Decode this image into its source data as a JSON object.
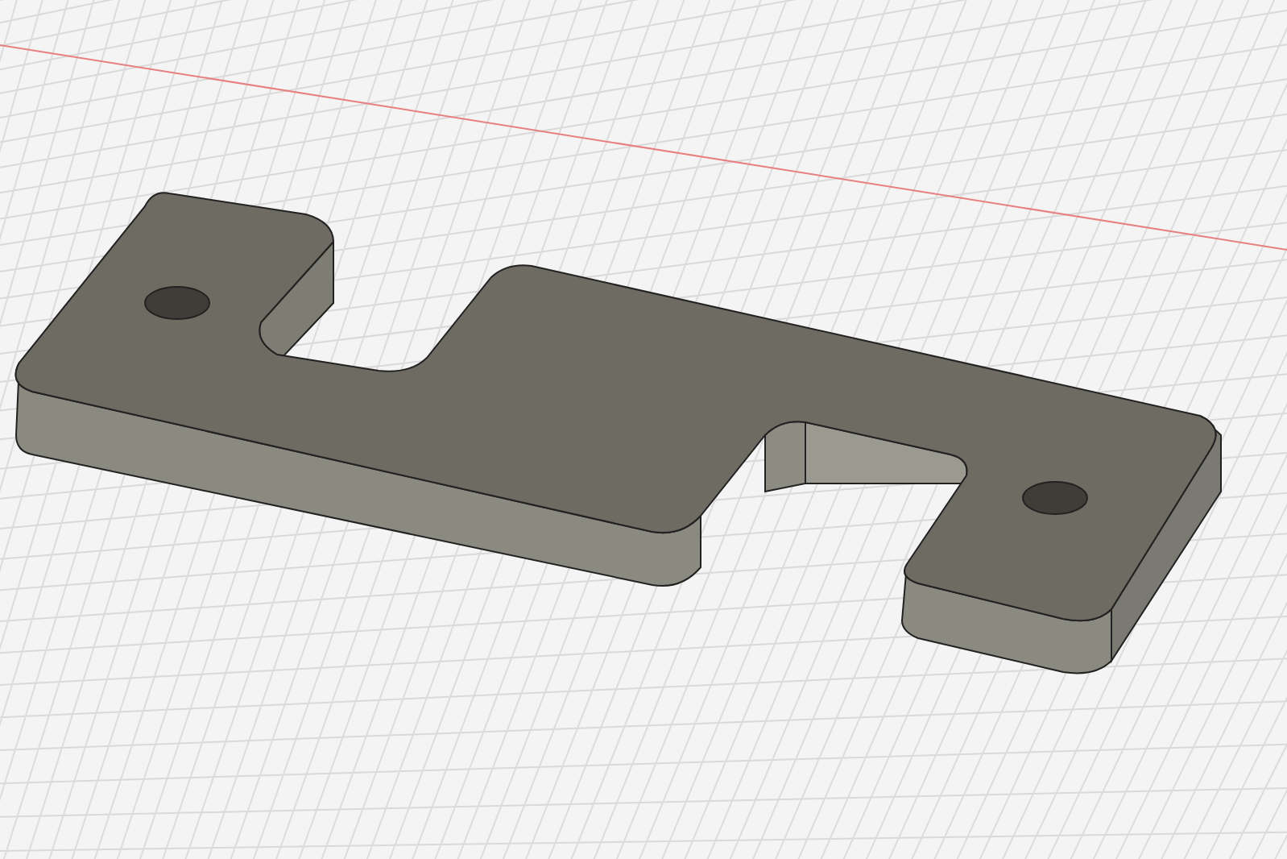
{
  "viewport": {
    "kind": "cad-3d"
  }
}
